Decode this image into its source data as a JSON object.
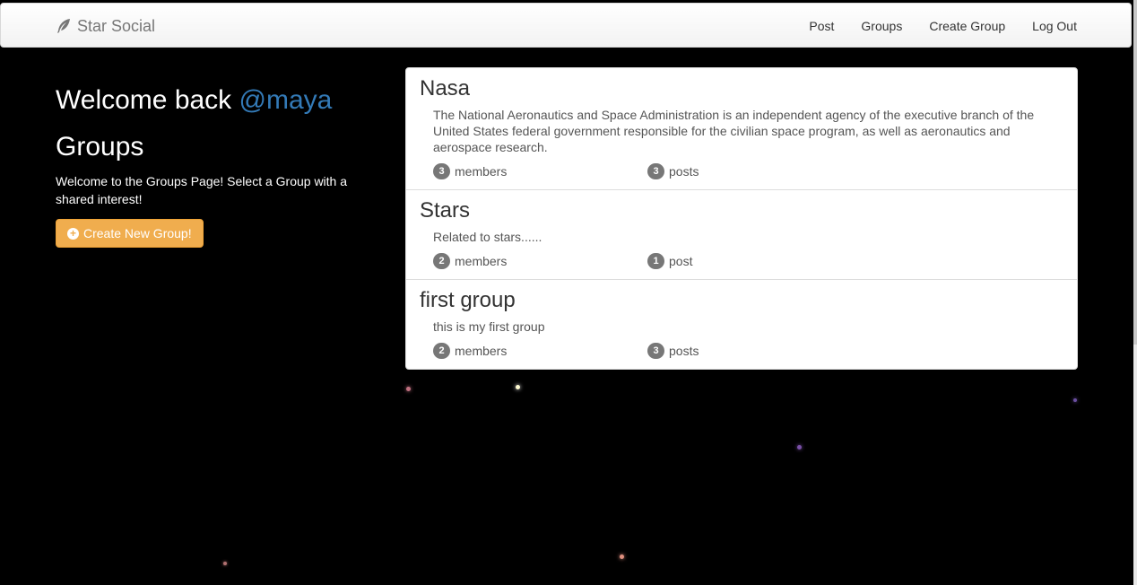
{
  "navbar": {
    "brand": "Star Social",
    "brand_icon": "feather-icon",
    "links": [
      "Post",
      "Groups",
      "Create Group",
      "Log Out"
    ]
  },
  "sidebar": {
    "welcome_prefix": "Welcome back ",
    "username": "@maya",
    "groups_title": "Groups",
    "intro": "Welcome to the Groups Page! Select a Group with a shared interest!",
    "create_button": "Create New Group!"
  },
  "groups": [
    {
      "name": "Nasa",
      "description": "The National Aeronautics and Space Administration is an independent agency of the executive branch of the United States federal government responsible for the civilian space program, as well as aeronautics and aerospace research.",
      "member_count": "3",
      "member_label": "members",
      "post_count": "3",
      "post_label": "posts"
    },
    {
      "name": "Stars",
      "description": "Related to stars......",
      "member_count": "2",
      "member_label": "members",
      "post_count": "1",
      "post_label": "post"
    },
    {
      "name": "first group",
      "description": "this is my first group",
      "member_count": "2",
      "member_label": "members",
      "post_count": "3",
      "post_label": "posts"
    }
  ],
  "colors": {
    "accent": "#337ab7",
    "button": "#f0ad4e",
    "badge": "#777777"
  }
}
